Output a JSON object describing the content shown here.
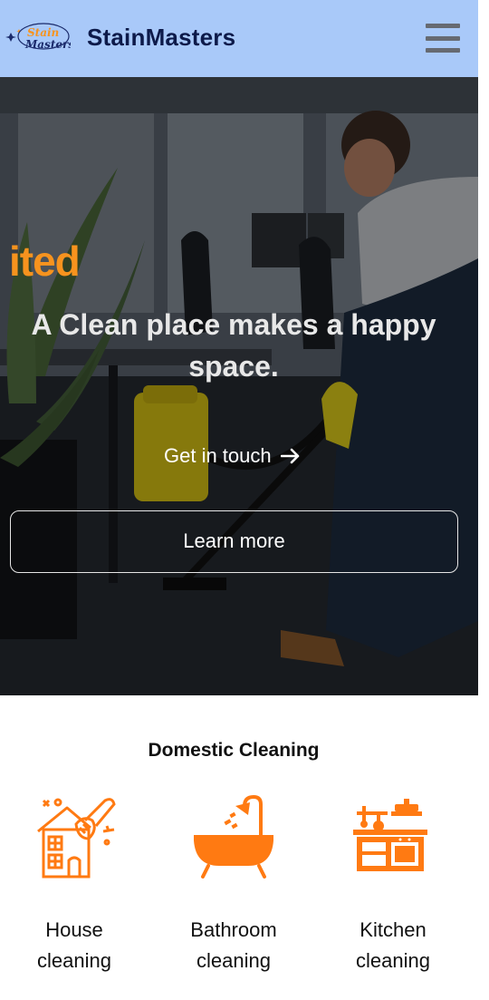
{
  "header": {
    "brand": "StainMasters",
    "logo_text": [
      "Stain",
      "Masters"
    ],
    "menu_icon": "hamburger-icon"
  },
  "hero": {
    "accent_fragment": "ited",
    "tagline_line1": "A Clean place makes a happy",
    "tagline_line2": "space.",
    "cta_primary": "Get in touch",
    "cta_primary_icon": "arrow-right-icon",
    "cta_secondary": "Learn more"
  },
  "services": {
    "title": "Domestic Cleaning",
    "items": [
      {
        "label": "House\ncleaning",
        "icon": "house-cleaning-icon"
      },
      {
        "label": "Bathroom\ncleaning",
        "icon": "bathtub-icon"
      },
      {
        "label": "Kitchen\ncleaning",
        "icon": "kitchen-icon"
      }
    ]
  },
  "colors": {
    "header_bg": "#a9c9f9",
    "brand_text": "#0d1a4a",
    "accent": "#f7931e",
    "icon_orange": "#ff7a12"
  }
}
